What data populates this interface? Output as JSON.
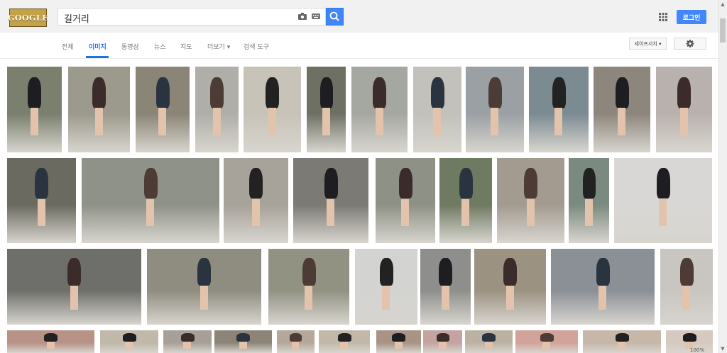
{
  "search": {
    "query": "길거리"
  },
  "header": {
    "login_label": "로그인"
  },
  "tabs": [
    {
      "label": "전체"
    },
    {
      "label": "이미지"
    },
    {
      "label": "동영상"
    },
    {
      "label": "뉴스"
    },
    {
      "label": "지도"
    },
    {
      "label": "더보기 ▾"
    },
    {
      "label": "검색 도구"
    }
  ],
  "toolbar": {
    "safesearch_label": "세이프서치 ▾"
  },
  "status": {
    "zoom": "100%"
  },
  "colors": {
    "accent": "#4285f4",
    "login": "#4387fd",
    "active_tab": "#1a73e8"
  },
  "icons": [
    "camera-icon",
    "keyboard-icon",
    "search-icon",
    "apps-icon",
    "gear-icon"
  ]
}
